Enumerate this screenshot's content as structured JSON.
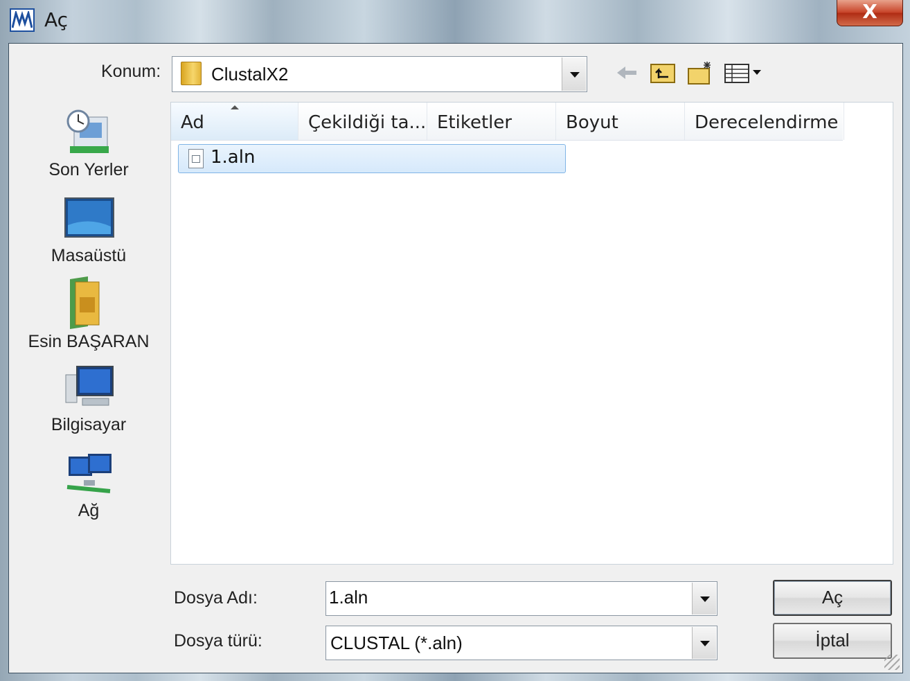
{
  "window": {
    "title": "Aç",
    "close_symbol": "X"
  },
  "look_in": {
    "label": "Konum:",
    "value": "ClustalX2"
  },
  "toolbar": {
    "icons": [
      "back-arrow-icon",
      "up-folder-icon",
      "new-folder-icon",
      "view-menu-icon"
    ]
  },
  "places": [
    {
      "label": "Son Yerler",
      "icon": "recent-places-icon"
    },
    {
      "label": "Masaüstü",
      "icon": "desktop-icon"
    },
    {
      "label": "Esin BAŞARAN",
      "icon": "user-folder-icon"
    },
    {
      "label": "Bilgisayar",
      "icon": "computer-icon"
    },
    {
      "label": "Ağ",
      "icon": "network-icon"
    }
  ],
  "columns": [
    "Ad",
    "Çekildiği ta...",
    "Etiketler",
    "Boyut",
    "Derecelendirme"
  ],
  "files": [
    {
      "name": "1.aln",
      "selected": true
    }
  ],
  "file_name": {
    "label": "Dosya Adı:",
    "value": "1.aln"
  },
  "file_type": {
    "label": "Dosya türü:",
    "value": "CLUSTAL (*.aln)"
  },
  "buttons": {
    "open": "Aç",
    "cancel": "İptal"
  },
  "colors": {
    "selection_bg": "#d6e9fb",
    "selection_border": "#7fb4e6",
    "close_red": "#c8452a"
  }
}
